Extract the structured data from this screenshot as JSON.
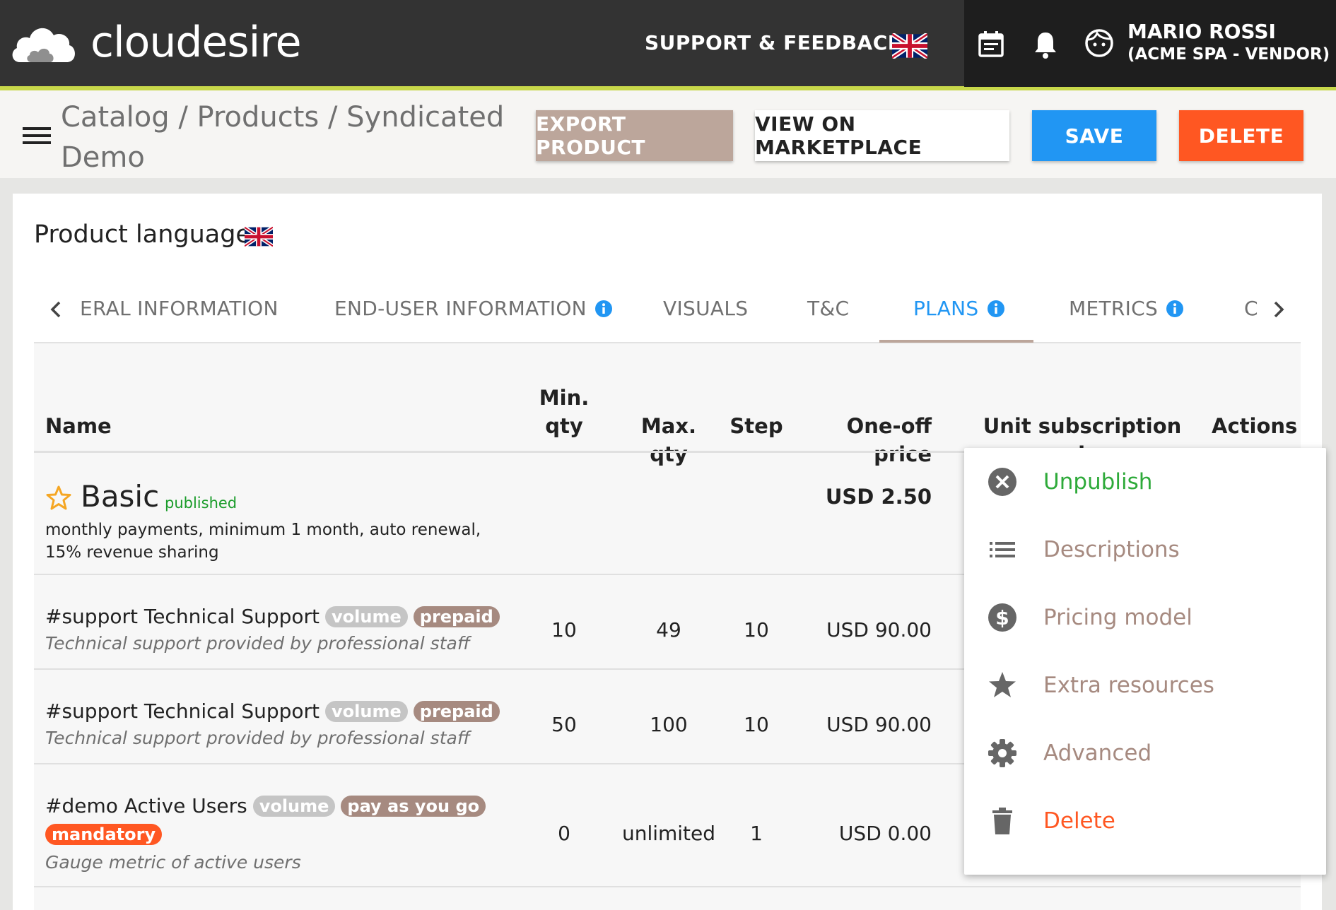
{
  "header": {
    "logo_text": "cloudesire",
    "support_label": "SUPPORT & FEEDBACK",
    "user_name": "MARIO ROSSI",
    "user_company": "(ACME SPA - VENDOR)"
  },
  "toolbar": {
    "breadcrumb": "Catalog / Products / Syndicated Demo",
    "export_label": "EXPORT PRODUCT",
    "view_label": "VIEW ON MARKETPLACE",
    "save_label": "SAVE",
    "delete_label": "DELETE"
  },
  "product_language": {
    "label": "Product language"
  },
  "tabs": [
    {
      "label": "ERAL INFORMATION"
    },
    {
      "label": "END-USER INFORMATION"
    },
    {
      "label": "VISUALS"
    },
    {
      "label": "T&C"
    },
    {
      "label": "PLANS"
    },
    {
      "label": "METRICS"
    },
    {
      "label": "C"
    }
  ],
  "table": {
    "headers": {
      "name": "Name",
      "min_qty_1": "Min.",
      "min_qty_2": "qty",
      "max_qty": "Max. qty",
      "step": "Step",
      "one_off": "One-off price",
      "unit_sub": "Unit subscription price",
      "actions": "Actions"
    },
    "plan": {
      "name": "Basic",
      "status": "published",
      "description": "monthly payments, minimum 1 month, auto renewal, 15% revenue sharing",
      "one_off": "USD 2.50"
    },
    "rows": [
      {
        "title": "#support Technical Support",
        "badges": [
          "volume",
          "prepaid"
        ],
        "description": "Technical support provided by professional staff",
        "min": "10",
        "max": "49",
        "step": "10",
        "price": "USD 90.00"
      },
      {
        "title": "#support Technical Support",
        "badges": [
          "volume",
          "prepaid"
        ],
        "description": "Technical support provided by professional staff",
        "min": "50",
        "max": "100",
        "step": "10",
        "price": "USD 90.00"
      },
      {
        "title": "#demo Active Users",
        "badges": [
          "volume",
          "pay as you go",
          "mandatory"
        ],
        "description": "Gauge metric of active users",
        "min": "0",
        "max": "unlimited",
        "step": "1",
        "price": "USD 0.00"
      }
    ]
  },
  "actions_menu": [
    {
      "label": "Unpublish",
      "icon": "cancel-circle-icon",
      "color": "#2eaa3a"
    },
    {
      "label": "Descriptions",
      "icon": "list-icon",
      "color": "#a68a80"
    },
    {
      "label": "Pricing model",
      "icon": "dollar-circle-icon",
      "color": "#a68a80"
    },
    {
      "label": "Extra resources",
      "icon": "star-icon",
      "color": "#a68a80"
    },
    {
      "label": "Advanced",
      "icon": "gear-icon",
      "color": "#a68a80"
    },
    {
      "label": "Delete",
      "icon": "trash-icon",
      "color": "#ff5722"
    }
  ],
  "colors": {
    "topbar": "#333333",
    "accent_line": "#c8d84a",
    "primary": "#2196f3",
    "danger": "#ff5722",
    "export": "#bca69b",
    "published": "#1a9c2a"
  }
}
